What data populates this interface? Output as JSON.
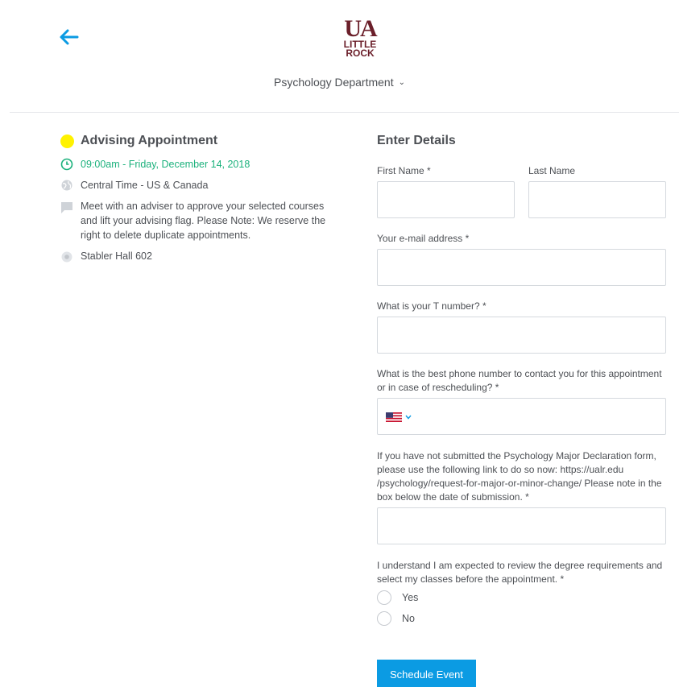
{
  "header": {
    "back_icon": "arrow-left-icon",
    "logo_line1": "UA",
    "logo_line2": "LITTLE",
    "logo_line3": "ROCK",
    "department": "Psychology Department",
    "dropdown_icon": "chevron-down-icon"
  },
  "event": {
    "color": "#fff200",
    "title": "Advising Appointment",
    "time": "09:00am - Friday, December 14, 2018",
    "timezone": "Central Time - US & Canada",
    "description": "Meet with an adviser to approve your selected courses and lift your advising flag. Please Note: We reserve the right to delete duplicate appointments.",
    "location": "Stabler Hall 602"
  },
  "form": {
    "title": "Enter Details",
    "first_name_label": "First Name *",
    "last_name_label": "Last Name",
    "email_label": "Your e-mail address *",
    "tnumber_label": "What is your T number? *",
    "phone_label": "What is the best phone number to contact you for this appointment or in case of rescheduling? *",
    "phone_country_icon": "us-flag-icon",
    "declaration_label": "If you have not submitted the Psychology Major Declaration form, please use the following link to do so now: https://ualr.edu /psychology/request-for-major-or-minor-change/ Please note in the box below the date of submission. *",
    "requirements_label": "I understand I am expected to review the degree requirements and select my classes before the appointment. *",
    "options": [
      "Yes",
      "No"
    ],
    "submit_label": "Schedule Event"
  },
  "colors": {
    "accent": "#0b9be3",
    "time_green": "#1bb17c",
    "brand_maroon": "#6b1f2a"
  }
}
